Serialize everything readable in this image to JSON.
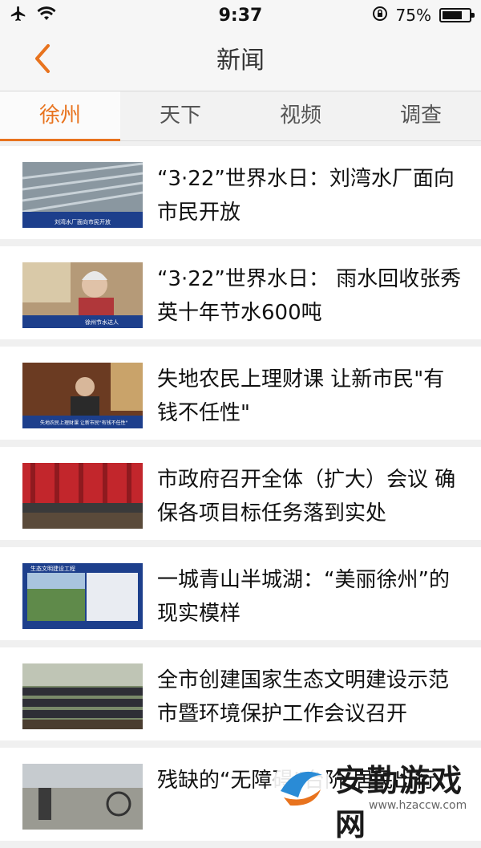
{
  "status_bar": {
    "time": "9:37",
    "battery": "75%",
    "battery_level": 0.75
  },
  "nav": {
    "title": "新闻",
    "back_icon": "chevron-left-icon"
  },
  "tabs": [
    {
      "label": "徐州",
      "active": true
    },
    {
      "label": "天下",
      "active": false
    },
    {
      "label": "视频",
      "active": false
    },
    {
      "label": "调查",
      "active": false
    }
  ],
  "news": [
    {
      "title": "“3·22”世界水日：刘湾水厂面向市民开放",
      "thumb_caption": "刘湾水厂面向市民开放"
    },
    {
      "title": "“3·22”世界水日： 雨水回收张秀英十年节水600吨",
      "thumb_caption": "徐州节水达人"
    },
    {
      "title": "失地农民上理财课 让新市民\"有钱不任性\"",
      "thumb_caption": "失地农民上理财课 让新市民\"有钱不任性\""
    },
    {
      "title": "市政府召开全体（扩大）会议 确保各项目标任务落到实处",
      "thumb_caption": ""
    },
    {
      "title": "一城青山半城湖：“美丽徐州”的现实模样",
      "thumb_caption": "生态文明建设工程"
    },
    {
      "title": "全市创建国家生态文明建设示范市暨环境保护工作会议召开",
      "thumb_caption": ""
    },
    {
      "title": "残缺的“无障碍”台阶 居民出行",
      "thumb_caption": ""
    }
  ],
  "watermark": {
    "text": "安勤游戏网",
    "url": "www.hzaccw.com"
  },
  "colors": {
    "accent": "#e8731e",
    "background": "#f0f0f0"
  }
}
